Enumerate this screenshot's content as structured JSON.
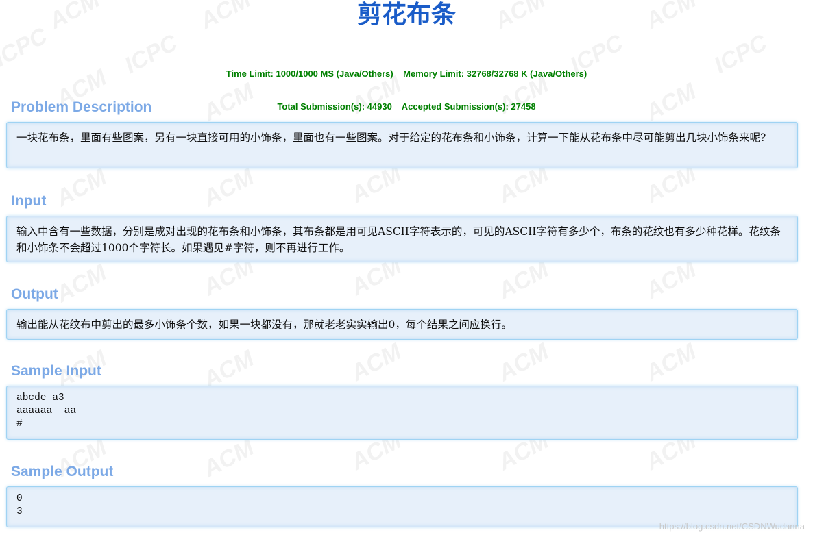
{
  "page": {
    "title": "剪花布条",
    "limits_line1": "Time Limit: 1000/1000 MS (Java/Others)    Memory Limit: 32768/32768 K (Java/Others)",
    "limits_line2": "Total Submission(s): 44930    Accepted Submission(s): 27458"
  },
  "sections": {
    "description": {
      "heading": "Problem Description",
      "text": "一块花布条，里面有些图案，另有一块直接可用的小饰条，里面也有一些图案。对于给定的花布条和小饰条，计算一下能从花布条中尽可能剪出几块小饰条来呢?"
    },
    "input": {
      "heading": "Input",
      "text": "输入中含有一些数据，分别是成对出现的花布条和小饰条，其布条都是用可见ASCII字符表示的，可见的ASCII字符有多少个，布条的花纹也有多少种花样。花纹条和小饰条不会超过1000个字符长。如果遇见#字符，则不再进行工作。"
    },
    "output": {
      "heading": "Output",
      "text": "输出能从花纹布中剪出的最多小饰条个数，如果一块都没有，那就老老实实输出0，每个结果之间应换行。"
    },
    "sample_input": {
      "heading": "Sample Input",
      "text": "abcde a3\naaaaaa  aa\n#"
    },
    "sample_output": {
      "heading": "Sample Output",
      "text": "0\n3"
    }
  },
  "watermark": {
    "text_acm": "ACM",
    "text_icpc": "ICPC",
    "footer": "https://blog.csdn.net/CSDNWudanna"
  }
}
